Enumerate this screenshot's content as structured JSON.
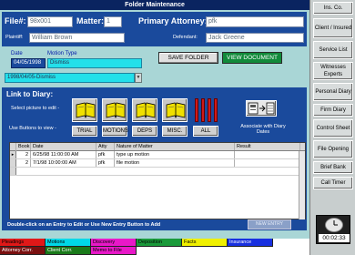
{
  "window": {
    "title": "Folder Maintenance"
  },
  "header": {
    "file_label": "File#:",
    "file_value": "98x001",
    "matter_label": "Matter:",
    "matter_value": "1",
    "primary_attorney_label": "Primary Attorney:",
    "primary_attorney_value": "pfk",
    "plaintiff_label": "Plaintiff:",
    "plaintiff_value": "William Brown",
    "defendant_label": "Defendant:",
    "defendant_value": "Jack Greene"
  },
  "motion": {
    "date_label": "Date",
    "date_value": "04/05/1998",
    "type_label": "Motion Type",
    "type_value": "Dismiss",
    "combo_value": "1998/04/05-Dismiss",
    "save_label": "SAVE FOLDER",
    "view_label": "VIEW DOCUMENT"
  },
  "diary": {
    "title": "Link to Diary:",
    "select_hint": "Select picture to edit -",
    "view_hint": "Use Buttons to view -",
    "associate_hint": "Associate with Diary Dates",
    "categories": [
      "TRIAL",
      "MOTIONS",
      "DEPS",
      "MISC.",
      "ALL"
    ],
    "columns": [
      "Book",
      "Date",
      "Atty",
      "Nature of Matter",
      "Result"
    ],
    "rows": [
      {
        "book": "2",
        "date": "6/25/98 11:00:00 AM",
        "atty": "pfk",
        "nature": "type up motion",
        "result": ""
      },
      {
        "book": "2",
        "date": "7/1/98 10:00:00 AM",
        "atty": "pfk",
        "nature": "file motion",
        "result": ""
      }
    ],
    "instruction": "Double-click on an Entry to Edit or Use New Entry Button to Add",
    "new_entry_label": "NEW ENTRY"
  },
  "tabs": [
    {
      "label": "Pleadings",
      "color": "#e01818"
    },
    {
      "label": "Motions",
      "color": "#00d8e8"
    },
    {
      "label": "Discovery",
      "color": "#e818c8"
    },
    {
      "label": "Deposition",
      "color": "#1a9a3a"
    },
    {
      "label": "Facts",
      "color": "#f0f000"
    },
    {
      "label": "Insurance",
      "color": "#1830e0"
    },
    {
      "label": "Attorney Corr.",
      "color": "#7a1010"
    },
    {
      "label": "Client Corr.",
      "color": "#1a7a1a"
    },
    {
      "label": "Memo to File",
      "color": "#e818c8"
    }
  ],
  "sidebar": {
    "buttons": [
      "Ins. Co.",
      "Client / Insured",
      "Service List",
      "Witnesses Experts",
      "Personal Diary",
      "Firm Diary",
      "Control Sheet",
      "File Opening",
      "Brief Bank",
      "Call Timer"
    ]
  },
  "clock": {
    "time": "00:02:33"
  }
}
